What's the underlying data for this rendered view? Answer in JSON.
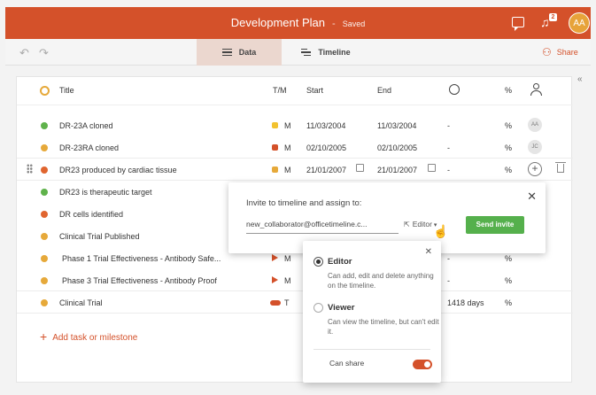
{
  "header": {
    "title": "Development Plan",
    "separator": "-",
    "status": "Saved",
    "notification_count": "2",
    "avatar_initials": "AA"
  },
  "toolbar": {
    "undo_icon": "↶",
    "redo_icon": "↷",
    "tabs": [
      {
        "label": "Data",
        "active": true
      },
      {
        "label": "Timeline",
        "active": false
      }
    ],
    "share_label": "Share"
  },
  "table": {
    "columns": {
      "title": "Title",
      "tm": "T/M",
      "start": "Start",
      "end": "End",
      "pct": "%"
    },
    "rows": [
      {
        "name": "DR-23A cloned",
        "dot": "#5fb24b",
        "marker": "square",
        "marker_color": "#f2c22f",
        "tm": "M",
        "start": "11/03/2004",
        "end": "11/03/2004",
        "duration": "-",
        "pct": "%",
        "avatar": "AA"
      },
      {
        "name": "DR-23RA cloned",
        "dot": "#e6a93a",
        "marker": "square",
        "marker_color": "#d4512a",
        "tm": "M",
        "start": "02/10/2005",
        "end": "02/10/2005",
        "duration": "-",
        "pct": "%",
        "avatar": "JC"
      },
      {
        "name": "DR23 produced by cardiac tissue",
        "dot": "#e0652f",
        "marker": "square",
        "marker_color": "#e6a93a",
        "tm": "M",
        "start": "21/01/2007",
        "end": "21/01/2007",
        "duration": "-",
        "pct": "%",
        "avatar": ""
      },
      {
        "name": "DR23 is therapeutic target",
        "dot": "#5fb24b",
        "marker": "",
        "marker_color": "",
        "tm": "",
        "start": "",
        "end": "",
        "duration": "",
        "pct": "",
        "avatar": ""
      },
      {
        "name": "DR cells identified",
        "dot": "#e0652f",
        "marker": "",
        "marker_color": "",
        "tm": "",
        "start": "",
        "end": "",
        "duration": "",
        "pct": "",
        "avatar": ""
      },
      {
        "name": "Clinical Trial Published",
        "dot": "#e6a93a",
        "marker": "",
        "marker_color": "",
        "tm": "",
        "start": "",
        "end": "",
        "duration": "",
        "pct": "",
        "avatar": ""
      },
      {
        "name": "Phase 1 Trial Effectiveness - Antibody Safe...",
        "dot": "#e6a93a",
        "marker": "flag",
        "marker_color": "#d4512a",
        "tm": "M",
        "start": "",
        "end": "",
        "duration": "-",
        "pct": "%",
        "avatar": ""
      },
      {
        "name": "Phase 3 Trial Effectiveness - Antibody Proof",
        "dot": "#e6a93a",
        "marker": "flag",
        "marker_color": "#d4512a",
        "tm": "M",
        "start": "",
        "end": "",
        "duration": "-",
        "pct": "%",
        "avatar": ""
      },
      {
        "name": "Clinical Trial",
        "dot": "#e6a93a",
        "marker": "pill",
        "marker_color": "#d4512a",
        "tm": "T",
        "start": "",
        "end": "",
        "duration": "1418 days",
        "pct": "%",
        "avatar": ""
      }
    ],
    "add_label": "Add task or milestone"
  },
  "invite": {
    "title": "Invite to timeline and assign to:",
    "email_value": "new_collaborator@officetimeline.c...",
    "role_label": "Editor",
    "send_label": "Send invite"
  },
  "role_menu": {
    "options": [
      {
        "label": "Editor",
        "description": "Can add, edit and delete anything on the timeline.",
        "selected": true
      },
      {
        "label": "Viewer",
        "description": "Can view the timeline, but can't edit it.",
        "selected": false
      }
    ],
    "can_share_label": "Can share",
    "can_share_on": true
  },
  "colors": {
    "brand": "#d4512a",
    "send": "#55b04c"
  }
}
